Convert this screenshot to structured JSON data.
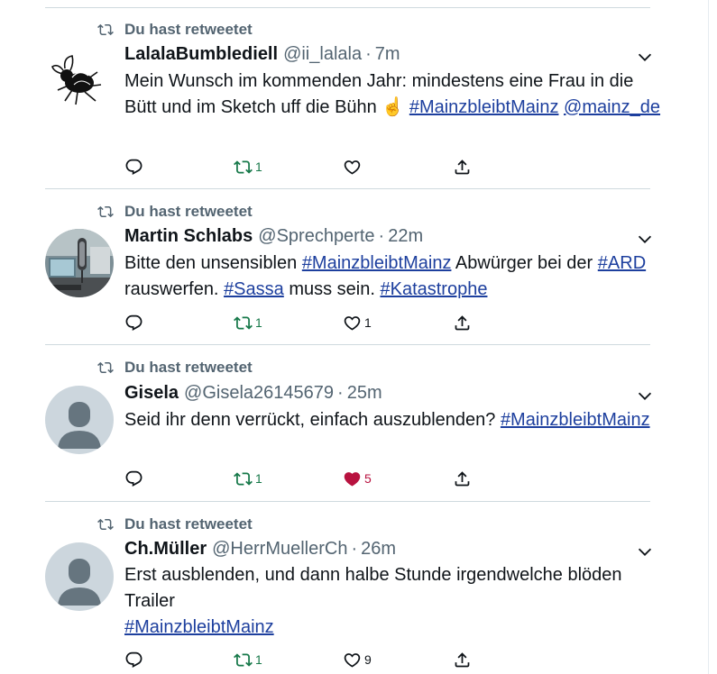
{
  "colors": {
    "retweeted": "#17794a",
    "liked": "#b8123f",
    "link": "#1d3f9e",
    "muted": "#536471",
    "divider": "#cfd9de"
  },
  "tweets": [
    {
      "retweet_label": "Du hast retweetet",
      "name": "LalalaBumblediell",
      "handle": "@ii_lalala",
      "separator": "·",
      "time": "7m",
      "avatar": "bee-avatar",
      "text_parts": [
        {
          "t": "Mein Wunsch im kommenden Jahr: mindestens eine Frau in die Bütt und im Sketch uff die Bühn ☝️ "
        },
        {
          "t": "#MainzbleibtMainz",
          "link": true
        },
        {
          "t": " "
        },
        {
          "t": "@mainz_de",
          "link": true
        }
      ],
      "reply_count": "",
      "retweet_count": "1",
      "like_count": "",
      "liked": false
    },
    {
      "retweet_label": "Du hast retweetet",
      "name": "Martin Schlabs",
      "handle": "@Sprechperte",
      "separator": "·",
      "time": "22m",
      "avatar": "studio-microphone-avatar",
      "text_parts": [
        {
          "t": "Bitte den unsensiblen "
        },
        {
          "t": "#MainzbleibtMainz",
          "link": true
        },
        {
          "t": " Abwürger bei der "
        },
        {
          "t": "#ARD",
          "link": true
        },
        {
          "t": " rauswerfen. "
        },
        {
          "t": "#Sassa",
          "link": true
        },
        {
          "t": " muss sein. "
        },
        {
          "t": "#Katastrophe",
          "link": true
        }
      ],
      "reply_count": "",
      "retweet_count": "1",
      "like_count": "1",
      "liked": false
    },
    {
      "retweet_label": "Du hast retweetet",
      "name": "Gisela",
      "handle": "@Gisela26145679",
      "separator": "·",
      "time": "25m",
      "avatar": "default-avatar",
      "text_parts": [
        {
          "t": "Seid ihr denn verrückt, einfach auszublenden? "
        },
        {
          "t": "#MainzbleibtMainz",
          "link": true
        }
      ],
      "reply_count": "",
      "retweet_count": "1",
      "like_count": "5",
      "liked": true
    },
    {
      "retweet_label": "Du hast retweetet",
      "name": "Ch.Müller",
      "handle": "@HerrMuellerCh",
      "separator": "·",
      "time": "26m",
      "avatar": "default-avatar",
      "text_parts": [
        {
          "t": "Erst ausblenden, und dann halbe Stunde irgendwelche blöden Trailer"
        },
        {
          "br": true
        },
        {
          "t": "#MainzbleibtMainz",
          "link": true
        }
      ],
      "reply_count": "",
      "retweet_count": "1",
      "like_count": "9",
      "liked": false
    }
  ]
}
